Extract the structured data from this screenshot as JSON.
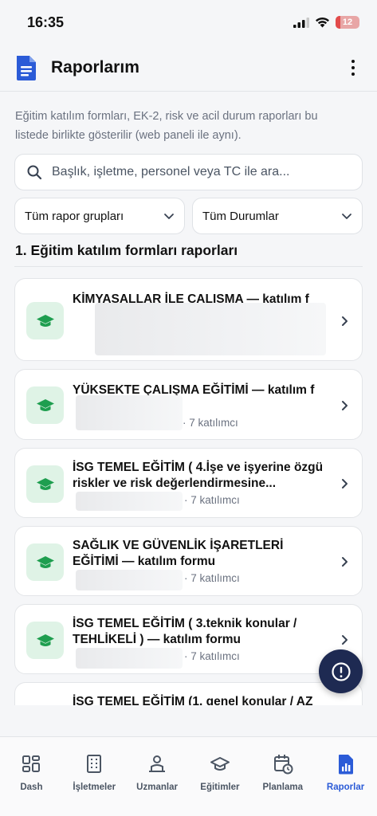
{
  "status_bar": {
    "time": "16:35",
    "battery": "12"
  },
  "header": {
    "title": "Raporlarım"
  },
  "description": "Eğitim katılım formları, EK-2, risk ve acil durum raporları bu listede birlikte gösterilir (web paneli ile aynı).",
  "search": {
    "placeholder": "Başlık, işletme, personel veya TC ile ara..."
  },
  "filters": [
    {
      "value": "Tüm rapor grupları"
    },
    {
      "value": "Tüm Durumlar"
    }
  ],
  "section": {
    "title": "1. Eğitim katılım formları raporları"
  },
  "reports": [
    {
      "title": "KİMYASALLAR İLE ÇALIŞMA — katılım f",
      "subtitle": ""
    },
    {
      "title": "YÜKSEKTE ÇALIŞMA EĞİTİMİ — katılım f",
      "subtitle": "· 7 katılımcı"
    },
    {
      "title": "İSG TEMEL EĞİTİM ( 4.İşe ve işyerine özgü riskler ve risk değerlendirmesine...",
      "subtitle": "· 7 katılımcı"
    },
    {
      "title": "SAĞLIK VE GÜVENLİK İŞARETLERİ EĞİTİMİ — katılım formu",
      "subtitle": "· 7 katılımcı"
    },
    {
      "title": "İSG TEMEL EĞİTİM ( 3.teknik konular / TEHLİKELİ ) — katılım formu",
      "subtitle": "· 7 katılımcı"
    },
    {
      "title": "İSG TEMEL EĞİTİM (1. genel konular / AZ",
      "subtitle": ""
    }
  ],
  "nav": [
    {
      "label": "Dash",
      "icon": "dashboard-icon"
    },
    {
      "label": "İşletmeler",
      "icon": "building-icon"
    },
    {
      "label": "Uzmanlar",
      "icon": "experts-icon"
    },
    {
      "label": "Eğitimler",
      "icon": "graduation-cap-icon"
    },
    {
      "label": "Planlama",
      "icon": "calendar-clock-icon"
    },
    {
      "label": "Raporlar",
      "icon": "report-chart-icon",
      "active": true
    }
  ],
  "colors": {
    "accent": "#2b5bd7",
    "fab": "#1e2a52",
    "card_icon_bg": "#dff3e6",
    "card_icon_fg": "#1e9e4f"
  }
}
